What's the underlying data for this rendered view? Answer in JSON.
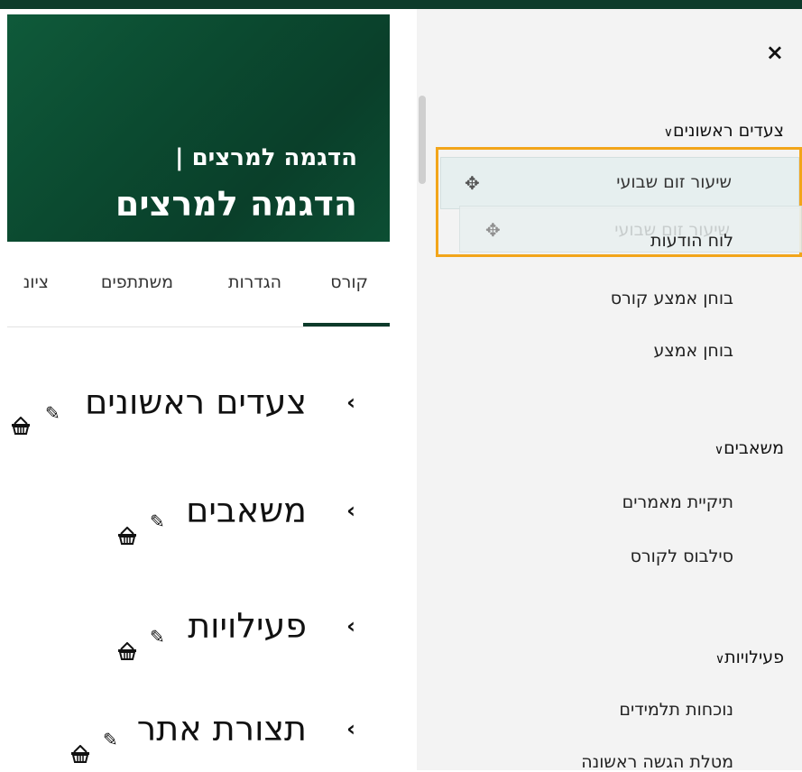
{
  "banner": {
    "subtitle": "הדגמה למרצים |",
    "title": "הדגמה למרצים"
  },
  "tabs": [
    "קורס",
    "הגדרות",
    "משתתפים",
    "ציונ"
  ],
  "active_tab": "קורס",
  "course_sections": [
    {
      "title": "צעדים ראשונים"
    },
    {
      "title": "משאבים"
    },
    {
      "title": "פעילויות"
    },
    {
      "title": "תצורת אתר"
    }
  ],
  "drawer": {
    "close_icon": "×",
    "sections": [
      {
        "title": "צעדים ראשונים",
        "items": [
          "שיעור זום שבועי",
          "לוח הודעות",
          "בוחן אמצע קורס",
          "בוחן אמצע"
        ]
      },
      {
        "title": "משאבים",
        "items": [
          "תיקיית מאמרים",
          "סילבוס לקורס"
        ]
      },
      {
        "title": "פעילויות",
        "items": [
          "נוכחות תלמידים",
          "מטלת הגשה ראשונה"
        ]
      }
    ],
    "dragging_item": "שיעור זום שבועי",
    "ghost_item": "שיעור זום שבועי"
  },
  "colors": {
    "brand_green": "#0d3b2b",
    "drop_highlight": "#f2a51a",
    "drawer_bg": "#f3f3f3"
  }
}
